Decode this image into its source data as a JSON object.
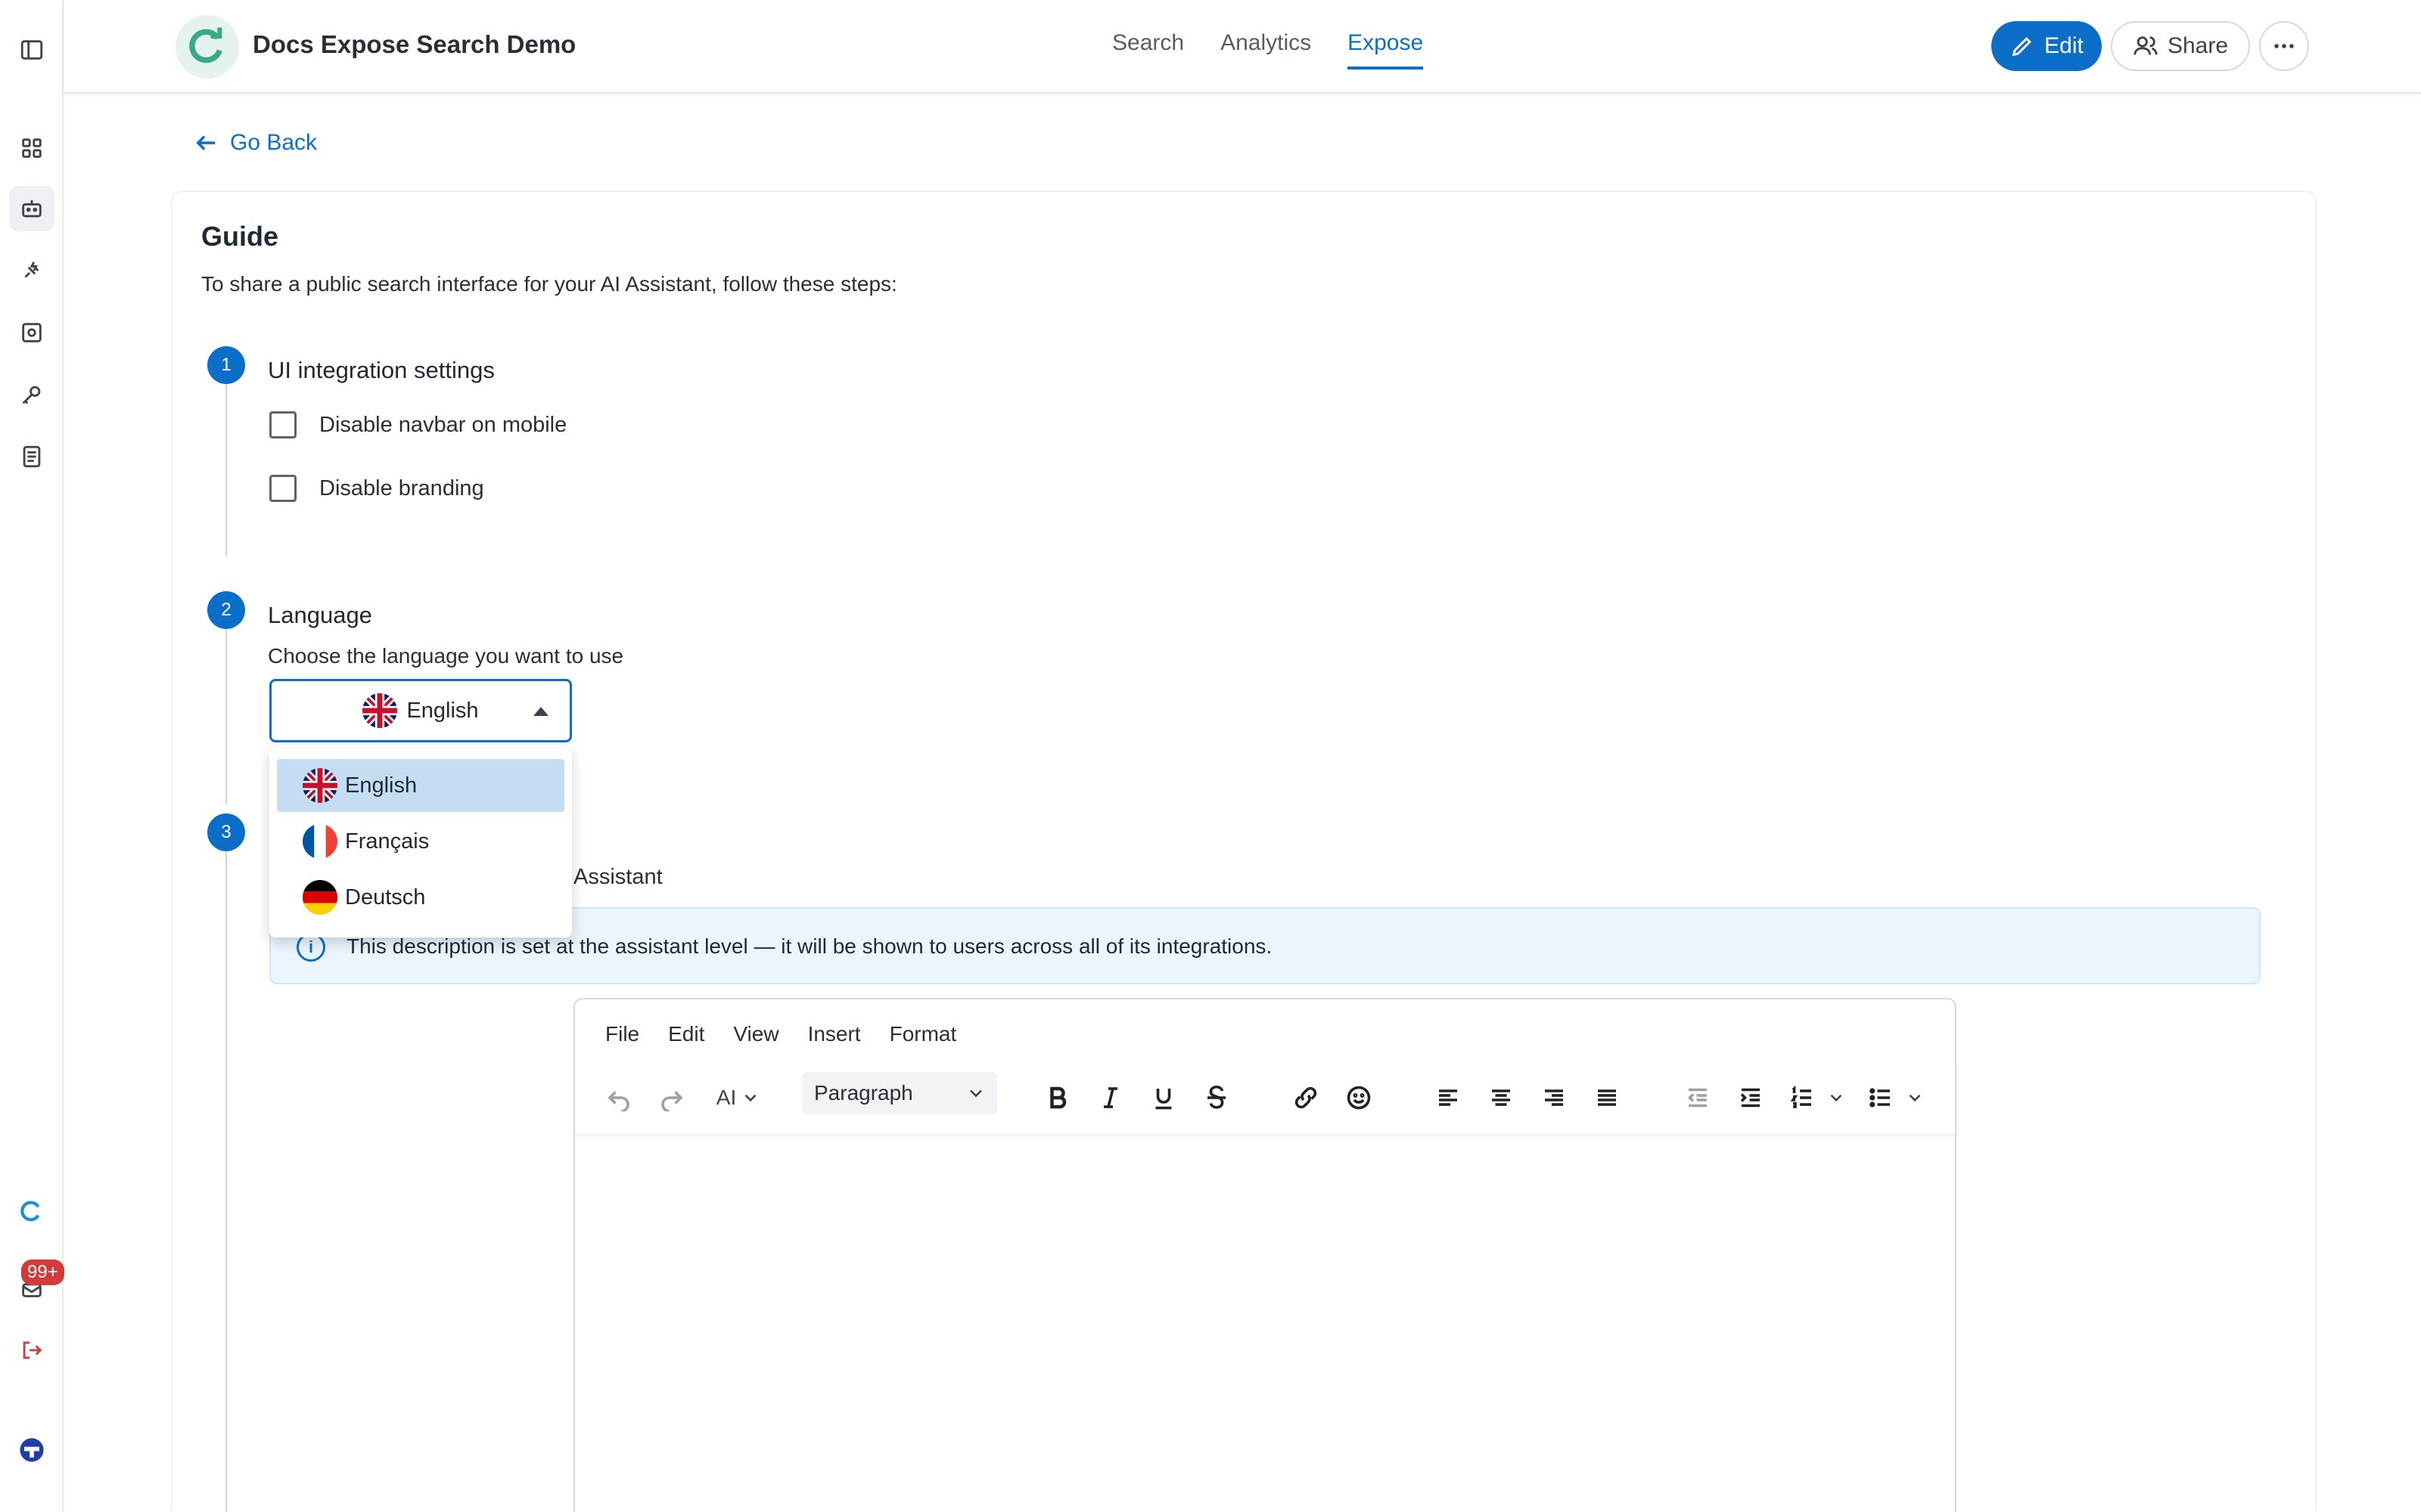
{
  "app": {
    "title": "Docs Expose Search Demo"
  },
  "nav": {
    "tabs": [
      {
        "label": "Search",
        "active": false
      },
      {
        "label": "Analytics",
        "active": false
      },
      {
        "label": "Expose",
        "active": true
      }
    ]
  },
  "header_actions": {
    "edit_label": "Edit",
    "share_label": "Share"
  },
  "sidebar": {
    "icons": [
      "panel-toggle-icon",
      "grid-icon",
      "bot-icon",
      "plug-icon",
      "scan-icon",
      "key-icon",
      "book-icon"
    ],
    "notification_count": "99+"
  },
  "main": {
    "go_back": "Go Back",
    "guide_title": "Guide",
    "guide_desc": "To share a public search interface for your AI Assistant, follow these steps:",
    "step1": {
      "num": "1",
      "title": "UI integration settings",
      "options": [
        {
          "label": "Disable navbar on mobile",
          "checked": false
        },
        {
          "label": "Disable branding",
          "checked": false
        }
      ]
    },
    "step2": {
      "num": "2",
      "title": "Language",
      "label": "Choose the language you want to use",
      "selected": "English",
      "options": [
        "English",
        "Français",
        "Deutsch"
      ]
    },
    "step3": {
      "num": "3",
      "partial_label": "Assistant",
      "info": "This description is set at the assistant level — it will be shown to users across all of its integrations."
    }
  },
  "editor": {
    "menu": [
      "File",
      "Edit",
      "View",
      "Insert",
      "Format"
    ],
    "ai_label": "AI",
    "block_format": "Paragraph"
  },
  "colors": {
    "accent": "#0b6fc9",
    "selected_option": "#c4ddf3",
    "info_bg": "#eaf5fd",
    "badge": "#d13b3b"
  }
}
